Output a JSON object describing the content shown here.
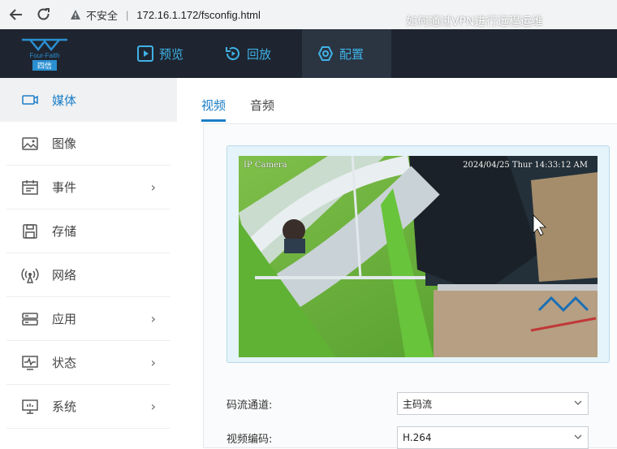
{
  "browser": {
    "security_label": "不安全",
    "url": "172.16.1.172/fsconfig.html",
    "overlay_title": "如何通过VPN进行远程运维"
  },
  "header": {
    "logo_text": "Four-Faith",
    "logo_cn": "四信",
    "tabs": [
      {
        "label": "预览"
      },
      {
        "label": "回放"
      },
      {
        "label": "配置"
      }
    ]
  },
  "sidebar": {
    "items": [
      {
        "label": "媒体",
        "icon": "camera-icon"
      },
      {
        "label": "图像",
        "icon": "image-icon"
      },
      {
        "label": "事件",
        "icon": "calendar-icon"
      },
      {
        "label": "存储",
        "icon": "save-icon"
      },
      {
        "label": "网络",
        "icon": "network-icon"
      },
      {
        "label": "应用",
        "icon": "apps-icon"
      },
      {
        "label": "状态",
        "icon": "status-icon"
      },
      {
        "label": "系统",
        "icon": "system-icon"
      }
    ]
  },
  "main": {
    "tabs": [
      {
        "label": "视频"
      },
      {
        "label": "音频"
      }
    ],
    "video": {
      "osd_name": "IP Camera",
      "osd_time": "2024/04/25 Thur 14:33:12 AM"
    },
    "form": {
      "stream_label": "码流通道:",
      "stream_value": "主码流",
      "codec_label": "视频编码:",
      "codec_value": "H.264"
    }
  },
  "colors": {
    "nav_bg": "#1e2530",
    "accent": "#1a7ec7",
    "nav_text": "#3fb2e6"
  }
}
